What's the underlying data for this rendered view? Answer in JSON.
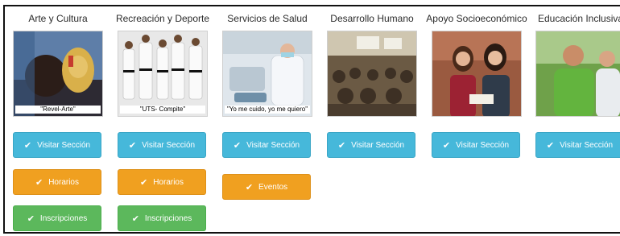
{
  "columns": [
    {
      "title": "Arte y Cultura",
      "caption": "\"Revel-Arte\"",
      "buttons": [
        {
          "label": "Visitar Sección",
          "kind": "info"
        },
        {
          "label": "Horarios",
          "kind": "warn"
        },
        {
          "label": "Inscripciones",
          "kind": "ok"
        }
      ]
    },
    {
      "title": "Recreación y Deporte",
      "caption": "\"UTS- Compite\"",
      "buttons": [
        {
          "label": "Visitar Sección",
          "kind": "info"
        },
        {
          "label": "Horarios",
          "kind": "warn"
        },
        {
          "label": "Inscripciones",
          "kind": "ok"
        }
      ]
    },
    {
      "title": "Servicios de Salud",
      "caption": "\"Yo me cuido, yo me quiero\"",
      "buttons": [
        {
          "label": "Visitar Sección",
          "kind": "info"
        },
        {
          "label": "Eventos",
          "kind": "warn"
        }
      ]
    },
    {
      "title": "Desarrollo Humano",
      "caption": "",
      "buttons": [
        {
          "label": "Visitar Sección",
          "kind": "info"
        }
      ]
    },
    {
      "title": "Apoyo Socioeconómico",
      "caption": "",
      "buttons": [
        {
          "label": "Visitar Sección",
          "kind": "info"
        }
      ]
    },
    {
      "title": "Educación Inclusiva",
      "caption": "",
      "buttons": [
        {
          "label": "Visitar Sección",
          "kind": "info"
        }
      ]
    }
  ],
  "icons": {
    "button_icon": "check-icon",
    "button_glyph": "✔"
  },
  "colors": {
    "info": "#46b8da",
    "warn": "#f0a020",
    "ok": "#5cb85c"
  }
}
